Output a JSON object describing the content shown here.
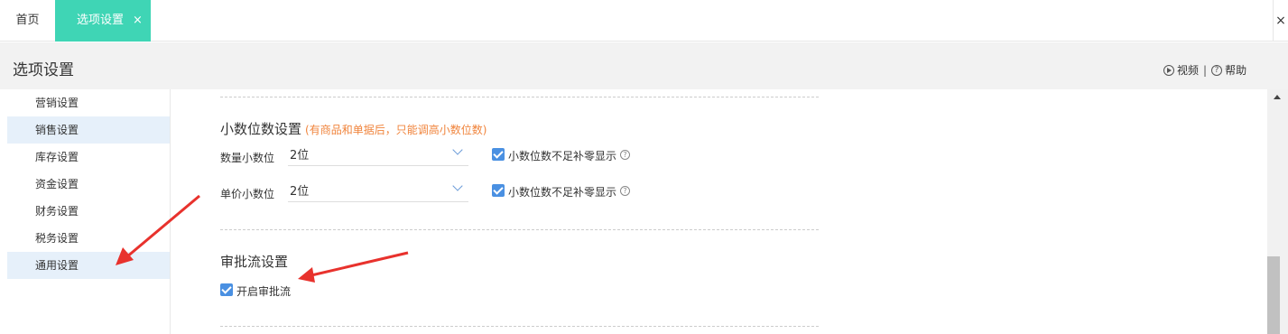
{
  "tabs": {
    "home_label": "首页",
    "active_label": "选项设置",
    "active_close": "×",
    "right_close": "×"
  },
  "header": {
    "title": "选项设置",
    "video_label": "视频",
    "separator": "|",
    "help_label": "帮助"
  },
  "sidebar": {
    "items": [
      {
        "label": "营销设置"
      },
      {
        "label": "销售设置"
      },
      {
        "label": "库存设置"
      },
      {
        "label": "资金设置"
      },
      {
        "label": "财务设置"
      },
      {
        "label": "税务设置"
      },
      {
        "label": "通用设置"
      }
    ]
  },
  "decimal_section": {
    "title": "小数位数设置",
    "note": "(有商品和单据后，只能调高小数位数)",
    "quantity": {
      "label": "数量小数位",
      "value": "2位",
      "checkbox_label": "小数位数不足补零显示",
      "checked": true
    },
    "price": {
      "label": "单价小数位",
      "value": "2位",
      "checkbox_label": "小数位数不足补零显示",
      "checked": true
    }
  },
  "approval_section": {
    "title": "审批流设置",
    "enable_label": "开启审批流",
    "enabled": true
  },
  "colors": {
    "accent_tab": "#3fd5b5",
    "note_orange": "#f0843c",
    "checkbox_blue": "#4a90e2",
    "annotation_red": "#e8322d"
  }
}
